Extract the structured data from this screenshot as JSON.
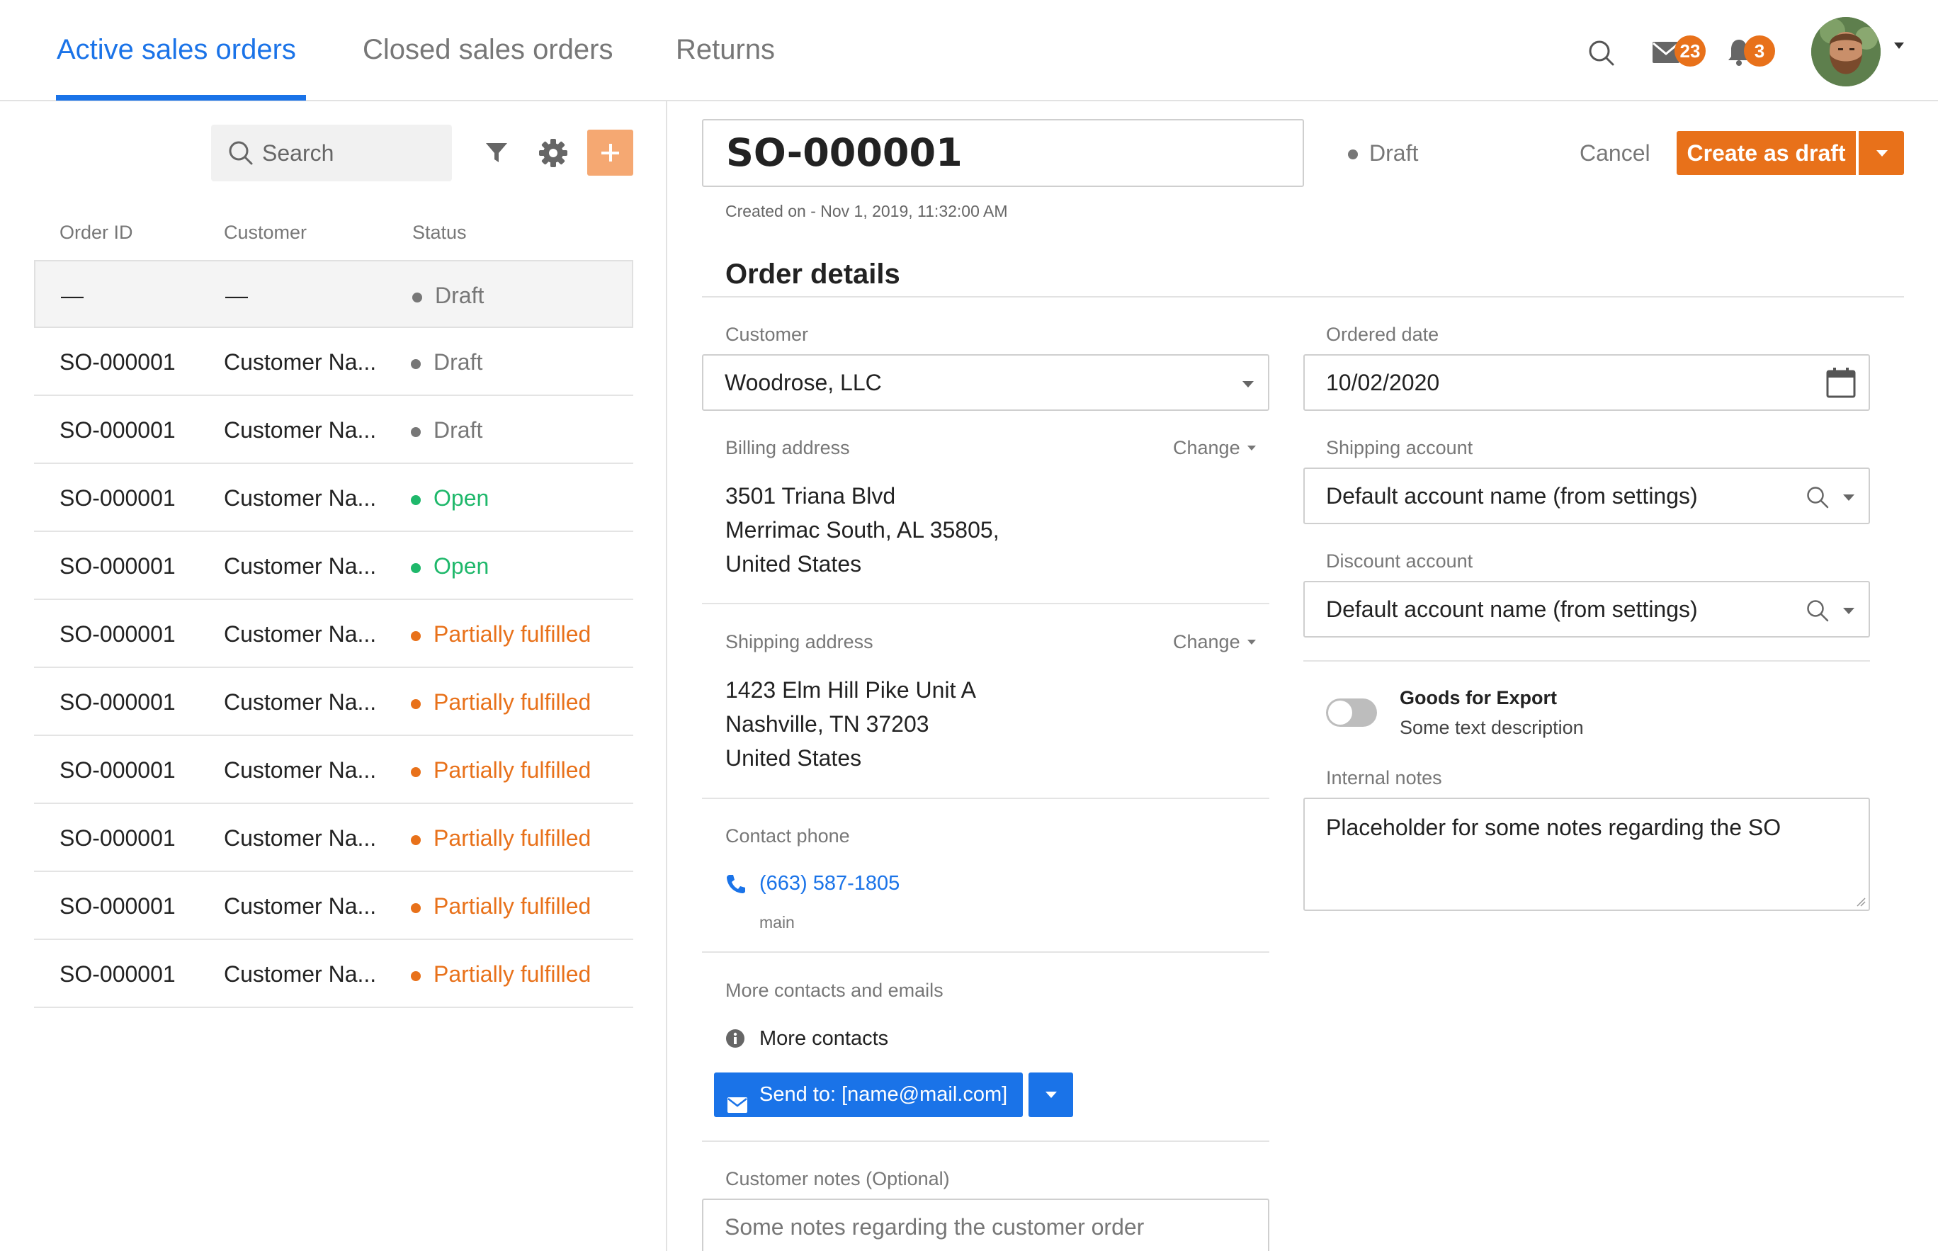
{
  "tabs": [
    {
      "label": "Active sales orders",
      "active": true
    },
    {
      "label": "Closed sales orders",
      "active": false
    },
    {
      "label": "Returns",
      "active": false
    }
  ],
  "header": {
    "mail_count": "23",
    "notification_count": "3",
    "icons": [
      "search-icon",
      "mail-icon",
      "bell-icon",
      "avatar",
      "chevron-down-icon"
    ]
  },
  "list": {
    "search_placeholder": "Search",
    "columns": {
      "order_id": "Order ID",
      "customer": "Customer",
      "status": "Status"
    },
    "rows": [
      {
        "id": "—",
        "customer": "—",
        "status": "Draft",
        "kind": "draft"
      },
      {
        "id": "SO-000001",
        "customer": "Customer Na...",
        "status": "Draft",
        "kind": "draft"
      },
      {
        "id": "SO-000001",
        "customer": "Customer Na...",
        "status": "Draft",
        "kind": "draft"
      },
      {
        "id": "SO-000001",
        "customer": "Customer Na...",
        "status": "Open",
        "kind": "open"
      },
      {
        "id": "SO-000001",
        "customer": "Customer Na...",
        "status": "Open",
        "kind": "open"
      },
      {
        "id": "SO-000001",
        "customer": "Customer Na...",
        "status": "Partially fulfilled",
        "kind": "partial"
      },
      {
        "id": "SO-000001",
        "customer": "Customer Na...",
        "status": "Partially fulfilled",
        "kind": "partial"
      },
      {
        "id": "SO-000001",
        "customer": "Customer Na...",
        "status": "Partially fulfilled",
        "kind": "partial"
      },
      {
        "id": "SO-000001",
        "customer": "Customer Na...",
        "status": "Partially fulfilled",
        "kind": "partial"
      },
      {
        "id": "SO-000001",
        "customer": "Customer Na...",
        "status": "Partially fulfilled",
        "kind": "partial"
      },
      {
        "id": "SO-000001",
        "customer": "Customer Na...",
        "status": "Partially fulfilled",
        "kind": "partial"
      }
    ]
  },
  "order": {
    "number": "SO-000001",
    "status": "Draft",
    "cancel_label": "Cancel",
    "primary_label": "Create as draft",
    "created_on": "Created on - Nov 1, 2019, 11:32:00 AM",
    "section_title": "Order details",
    "customer_label": "Customer",
    "customer_value": "Woodrose, LLC",
    "billing_label": "Billing address",
    "change_label": "Change",
    "billing_lines": [
      "3501 Triana Blvd",
      "Merrimac South, AL 35805,",
      "United States"
    ],
    "shipping_label": "Shipping address",
    "shipping_lines": [
      "1423 Elm Hill Pike Unit A",
      "Nashville, TN 37203",
      "United States"
    ],
    "contact_label": "Contact phone",
    "phone": "(663) 587-1805",
    "phone_type": "main",
    "more_label": "More contacts and emails",
    "more_contacts": "More contacts",
    "send_label": "Send to: [name@mail.com]",
    "customer_notes_label": "Customer notes (Optional)",
    "customer_notes_placeholder": "Some notes regarding the customer order",
    "ordered_date_label": "Ordered date",
    "ordered_date_value": "10/02/2020",
    "shipping_account_label": "Shipping account",
    "shipping_account_value": "Default account name (from settings)",
    "discount_account_label": "Discount account",
    "discount_account_value": "Default account name (from settings)",
    "export_title": "Goods for Export",
    "export_desc": "Some text description",
    "internal_notes_label": "Internal notes",
    "internal_notes_value": "Placeholder for some notes regarding the SO"
  },
  "colors": {
    "accent_blue": "#1a73e8",
    "accent_orange": "#e8711a",
    "status_open": "#1fb86b",
    "status_draft": "#777777"
  }
}
